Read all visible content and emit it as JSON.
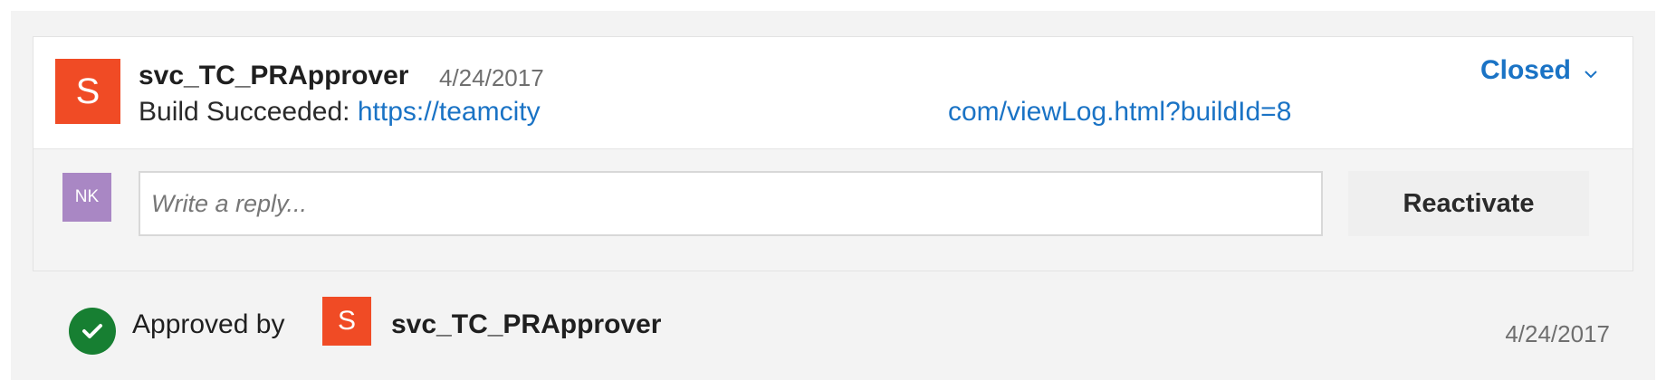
{
  "comment": {
    "avatar_initial": "S",
    "author": "svc_TC_PRApprover",
    "date": "4/24/2017",
    "message_prefix": "Build Succeeded:",
    "link_start": "https://teamcity",
    "link_end": "com/viewLog.html?buildId=8",
    "status": "Closed"
  },
  "reply": {
    "avatar_initials": "NK",
    "placeholder": "Write a reply...",
    "reactivate_label": "Reactivate"
  },
  "approval": {
    "text": "Approved by",
    "avatar_initial": "S",
    "approver": "svc_TC_PRApprover",
    "date": "4/24/2017"
  },
  "colors": {
    "accent": "#1a73c5",
    "avatar_orange": "#f04b25",
    "avatar_purple": "#a987c4",
    "approved_green": "#177f32"
  },
  "icons": {
    "status_dropdown": "chevron-down-icon",
    "approved": "check-circle-icon"
  }
}
